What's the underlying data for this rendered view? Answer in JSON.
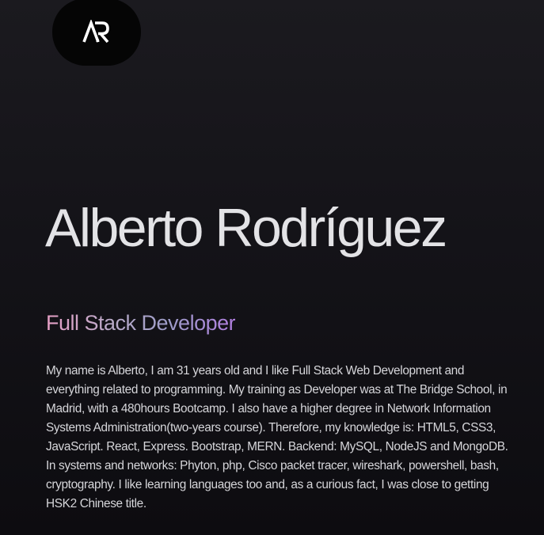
{
  "header": {
    "logo_text": "AR",
    "logo_icon": "ar-monogram-icon"
  },
  "hero": {
    "name": "Alberto Rodríguez",
    "role": "Full Stack Developer",
    "role_gradient": [
      "#e7a0c6",
      "#b8aac8",
      "#9d9cc8",
      "#b07ee0"
    ],
    "bio": "My name is Alberto, I am 31 years old and I like Full Stack Web Development and everything related to programming. My training as Developer was at The Bridge School, in Madrid, with a 480hours Bootcamp. I also have a higher degree in Network Information Systems Administration(two-years course). Therefore, my knowledge is: HTML5, CSS3, JavaScript. React, Express. Bootstrap, MERN. Backend: MySQL, NodeJS and MongoDB. In systems and networks: Phyton, php, Cisco packet tracer, wireshark, powershell, bash, cryptography. I like learning languages too and, as a curious fact, I was close to getting HSK2 Chinese title."
  },
  "colors": {
    "background_top": "#1b1a1f",
    "background_bottom": "#0d0c10",
    "logo_background": "#050505",
    "name_text": "#e3e3e6",
    "bio_text": "#d6d6da"
  }
}
